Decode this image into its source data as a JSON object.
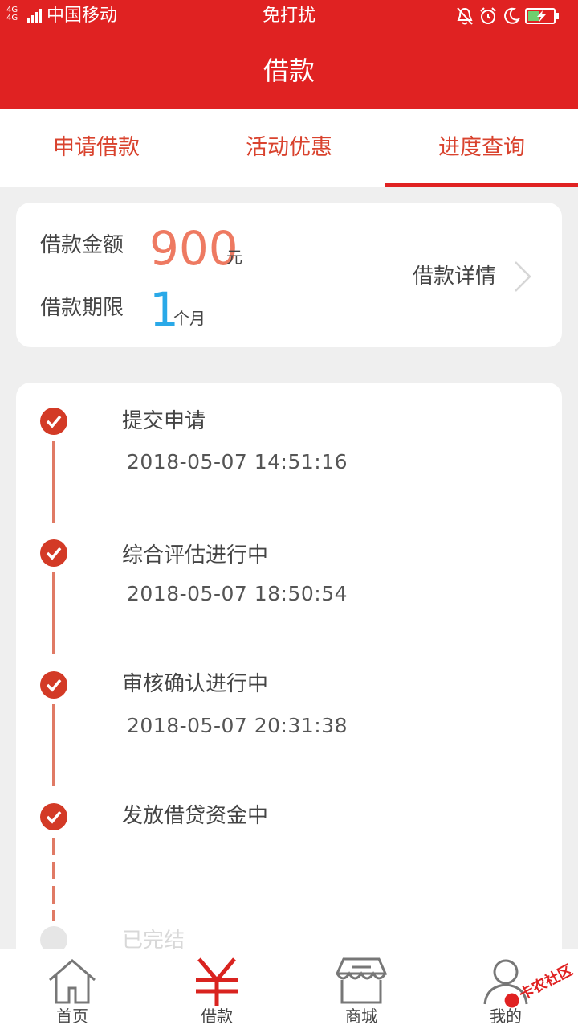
{
  "status_bar": {
    "network": "4G 4G",
    "carrier": "中国移动",
    "mode": "免打扰",
    "icons": [
      "bell-muted-icon",
      "alarm-icon",
      "moon-icon",
      "battery-charging-icon"
    ]
  },
  "header": {
    "title": "借款"
  },
  "tabs": [
    {
      "label": "申请借款",
      "active": false
    },
    {
      "label": "活动优惠",
      "active": false
    },
    {
      "label": "进度查询",
      "active": true
    }
  ],
  "loan": {
    "amount_label": "借款金额",
    "amount": "900",
    "amount_unit": "元",
    "term_label": "借款期限",
    "term": "1",
    "term_unit": "个月",
    "detail_label": "借款详情"
  },
  "timeline": [
    {
      "title": "提交申请",
      "time": "2018-05-07 14:51:16",
      "done": true
    },
    {
      "title": "综合评估进行中",
      "time": "2018-05-07 18:50:54",
      "done": true
    },
    {
      "title": "审核确认进行中",
      "time": "2018-05-07 20:31:38",
      "done": true
    },
    {
      "title": "发放借贷资金中",
      "time": "",
      "done": true
    },
    {
      "title": "已完结",
      "time": "",
      "done": false
    }
  ],
  "bottom_nav": [
    {
      "label": "首页",
      "icon": "home-icon"
    },
    {
      "label": "借款",
      "icon": "yuan-icon",
      "active": true
    },
    {
      "label": "商城",
      "icon": "shop-icon"
    },
    {
      "label": "我的",
      "icon": "user-icon"
    }
  ],
  "watermark": {
    "text": "卡农社区"
  },
  "colors": {
    "brand_red": "#e02222",
    "amount_orange": "#ee7a62",
    "term_blue": "#2aa9e8",
    "step_red": "#d33a26"
  }
}
